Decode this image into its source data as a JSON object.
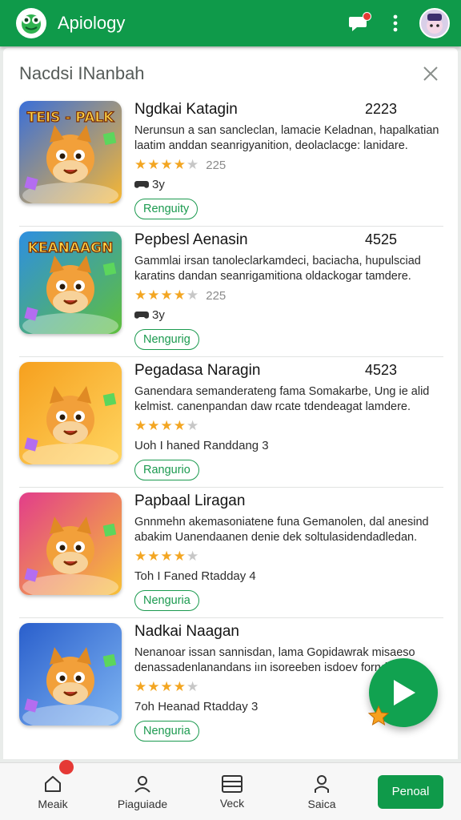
{
  "app": {
    "title": "Apiology",
    "logo_icon": "frog-logo-icon",
    "accent": "#0f9a4a"
  },
  "topbar": {
    "chat_icon": "chat-bubble-icon",
    "chat_has_notification": true,
    "more_icon": "more-vertical-icon",
    "avatar_icon": "avatar-icon"
  },
  "sheet": {
    "title": "Nacdsi INanbah",
    "close_icon": "close-icon"
  },
  "items": [
    {
      "title": "Ngdkai Katagin",
      "count": "2223",
      "description": "Nerunsun a san sancleclan, lamacie Keladnan, hapalkatian laatim anddan seanrigyanition, deolaclacge: lanidare.",
      "stars": 4,
      "rating_count": "225",
      "meta": "3y",
      "meta_icon": "gamepad-icon",
      "button": "Renguity",
      "thumb_caption": "TEIS - PALK",
      "thumb_colors": [
        "#3a6fd8",
        "#f7b733"
      ]
    },
    {
      "title": "Pepbesl Aenasin",
      "count": "4525",
      "description": "Gammlai irsan tanoleclarkamdeci, baciacha, hupulsciad karatins dandan seanrigamitiona oldackogar tamdere.",
      "stars": 4,
      "rating_count": "225",
      "meta": "3y",
      "meta_icon": "gamepad-icon",
      "button": "Nengurig",
      "thumb_caption": "KEANAAGN",
      "thumb_colors": [
        "#2e8fe0",
        "#5fbf3d"
      ]
    },
    {
      "title": "Pegadasa Naragin",
      "count": "4523",
      "description": "Ganendara semanderateng fama Somakarbe, Ung ie alid kelmist. canenpandan daw rcate tdendeagat lamdere.",
      "stars": 4,
      "rating_count": "",
      "meta": "Uoh I haned Randdang 3",
      "meta_icon": "",
      "button": "Rangurio",
      "thumb_caption": "",
      "thumb_colors": [
        "#f6a01e",
        "#ffd560"
      ]
    },
    {
      "title": "Papbaal Liragan",
      "count": "",
      "description": "Gnnmehn akemasoniatene funa Gemanolen, dal anesind abakim Uanendaanen denie dek soltulasidendadledan.",
      "stars": 4,
      "rating_count": "",
      "meta": "Toh I Faned Rtadday 4",
      "meta_icon": "",
      "button": "Nenguria",
      "thumb_caption": "",
      "thumb_colors": [
        "#e23d8a",
        "#f7c136"
      ]
    },
    {
      "title": "Nadkai Naagan",
      "count": "",
      "description": "Nenanoar issan sannisdan, lama Gopidawrak misaeso denassadenlanandans iın isoreeben isdoev forndineden.",
      "stars": 4,
      "rating_count": "",
      "meta": "7oh Heanad Rtadday 3",
      "meta_icon": "",
      "button": "Nenguria",
      "thumb_caption": "",
      "thumb_colors": [
        "#2a5fcc",
        "#7fb5f2"
      ]
    }
  ],
  "fab": {
    "icon": "play-icon",
    "badge_icon": "star-badge-icon",
    "color": "#11a250"
  },
  "bottom_nav": {
    "items": [
      {
        "label": "Meaik",
        "icon": "home-icon",
        "has_dot": true
      },
      {
        "label": "Piaguiade",
        "icon": "person-icon",
        "has_dot": false
      },
      {
        "label": "Veck",
        "icon": "list-icon",
        "has_dot": false
      },
      {
        "label": "Saica",
        "icon": "profile-icon",
        "has_dot": false
      }
    ],
    "primary_button": "Penoal"
  }
}
